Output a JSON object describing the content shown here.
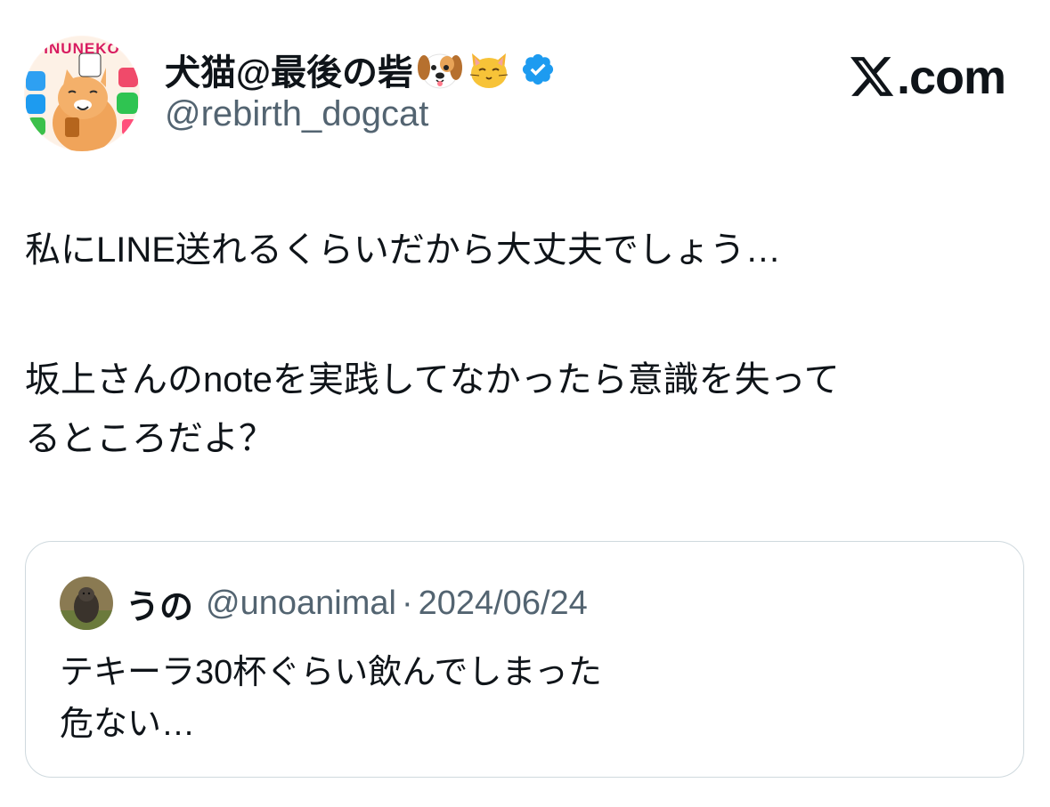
{
  "author": {
    "display_name": "犬猫@最後の砦",
    "emojis": [
      "dog-face-icon",
      "cat-face-icon"
    ],
    "verified": true,
    "handle": "@rebirth_dogcat",
    "avatar_label": "INUNEKO"
  },
  "brand": {
    "label": ".com",
    "logo": "x-logo-icon"
  },
  "tweet": {
    "line1": "私にLINE送れるくらいだから大丈夫でしょう…",
    "line2": "坂上さんのnoteを実践してなかったら意識を失って",
    "line3": "るところだよ？"
  },
  "quote": {
    "name": "うの",
    "handle": "@unoanimal",
    "separator": "·",
    "date": "2024/06/24",
    "line1": "テキーラ30杯ぐらい飲んでしまった",
    "line2": "危ない…"
  },
  "colors": {
    "text": "#0f1419",
    "secondary": "#536471",
    "verified": "#1d9bf0",
    "border": "#cfd9de"
  }
}
